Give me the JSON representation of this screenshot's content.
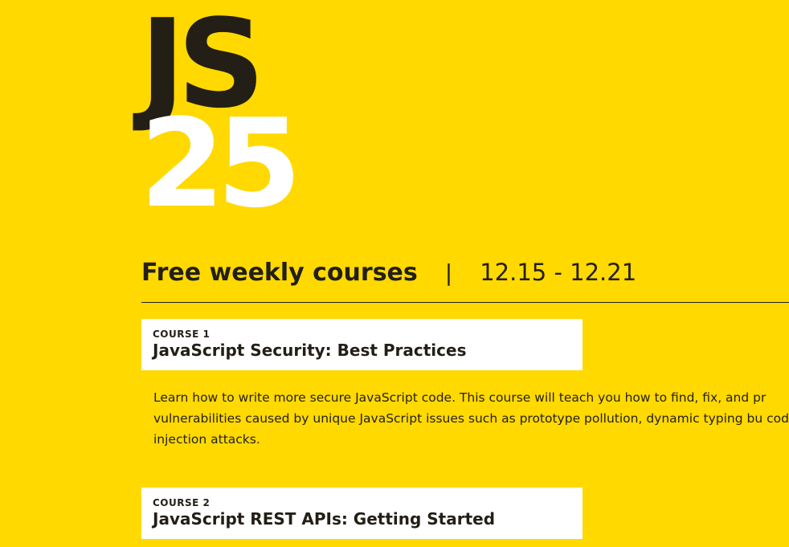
{
  "logo": {
    "line1": "JS",
    "line2": "25"
  },
  "headline": {
    "title": "Free weekly courses",
    "separator": "|",
    "dates": "12.15 - 12.21"
  },
  "courses": [
    {
      "label": "COURSE 1",
      "title": "JavaScript Security: Best Practices",
      "description": "Learn how to write more secure JavaScript code. This course will teach you how to find, fix, and pr vulnerabilities caused by unique JavaScript issues such as prototype pollution, dynamic typing bu code injection attacks."
    },
    {
      "label": "COURSE 2",
      "title": "JavaScript REST APIs: Getting Started"
    }
  ],
  "colors": {
    "background": "#FFD900",
    "ink": "#231F16",
    "card": "#FFFFFF"
  }
}
